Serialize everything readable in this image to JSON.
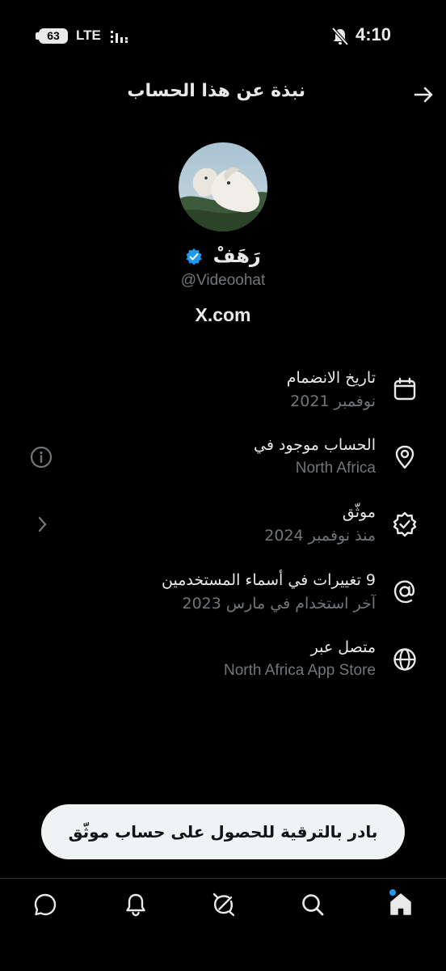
{
  "status_bar": {
    "battery": "63",
    "network": "LTE",
    "time": "4:10"
  },
  "header": {
    "title": "نبذة عن هذا الحساب"
  },
  "profile": {
    "display_name": "رَهَفْ",
    "handle": "@Videoohat",
    "website": "X.com"
  },
  "about": [
    {
      "label": "تاريخ الانضمام",
      "value": "نوفمبر 2021",
      "icon": "calendar-icon"
    },
    {
      "label": "الحساب موجود في",
      "value": "North Africa",
      "icon": "location-pin-icon",
      "side_icon": "info-icon"
    },
    {
      "label": "موثّق",
      "value": "منذ نوفمبر 2024",
      "icon": "verified-badge-icon",
      "side_icon": "chevron-left-icon"
    },
    {
      "label": "9 تغييرات في أسماء المستخدمين",
      "value": "آخر استخدام في مارس 2023",
      "icon": "at-sign-icon"
    },
    {
      "label": "متصل عبر",
      "value": "North Africa App Store",
      "icon": "globe-icon"
    }
  ],
  "cta": {
    "label": "بادر بالترقية للحصول على حساب موثّق"
  },
  "colors": {
    "background": "#000000",
    "text_primary": "#e7e9ea",
    "text_secondary": "#71767b",
    "accent": "#1d9bf0",
    "button_bg": "#eff3f4"
  },
  "bottom_nav": [
    "messages-icon",
    "notifications-icon",
    "grok-icon",
    "search-icon",
    "home-icon"
  ]
}
